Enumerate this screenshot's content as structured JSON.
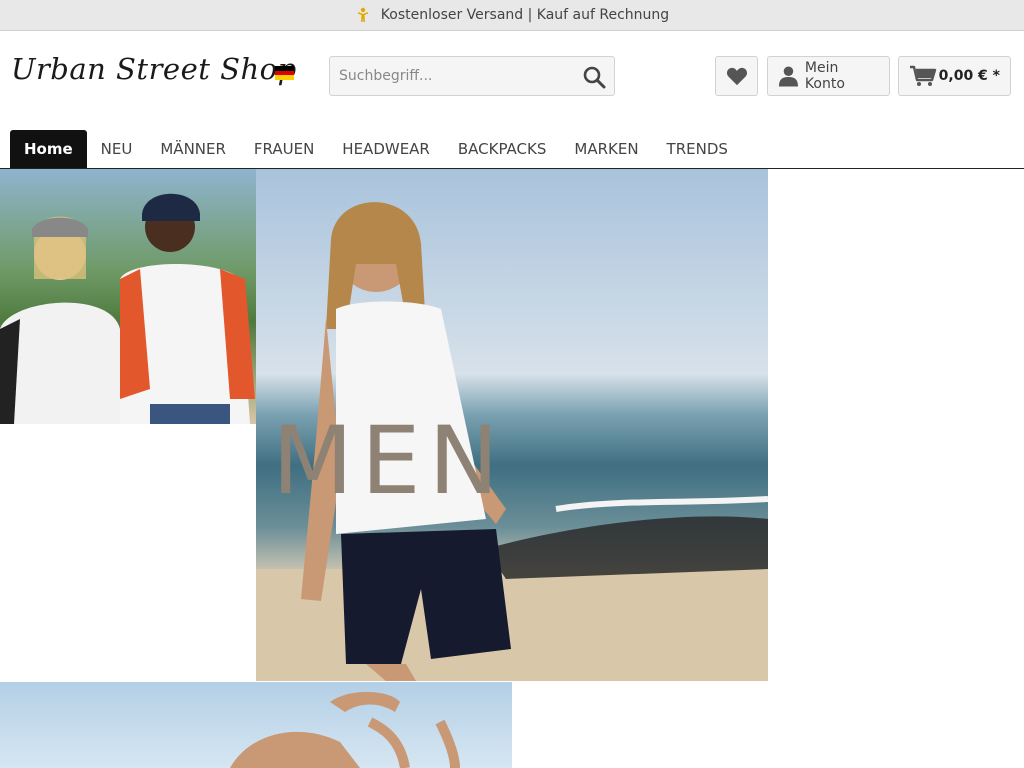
{
  "promo": {
    "text": "Kostenloser Versand | Kauf auf Rechnung",
    "icon": "shipping-person-icon"
  },
  "header": {
    "logo_text": "Urban Street Shop",
    "language_flag": "de-flag-icon",
    "search": {
      "placeholder": "Suchbegriff..."
    },
    "wishlist_icon": "heart-icon",
    "account_label": "Mein Konto",
    "cart_total": "0,00 € *"
  },
  "nav": {
    "items": [
      {
        "label": "Home",
        "active": true
      },
      {
        "label": "NEU"
      },
      {
        "label": "MÄNNER"
      },
      {
        "label": "FRAUEN"
      },
      {
        "label": "HEADWEAR"
      },
      {
        "label": "BACKPACKS"
      },
      {
        "label": "MARKEN"
      },
      {
        "label": "TRENDS"
      }
    ]
  },
  "tiles": {
    "men_label": "MEN"
  },
  "colors": {
    "nav_active_bg": "#111111",
    "topbar_bg": "#e8e8e8"
  }
}
